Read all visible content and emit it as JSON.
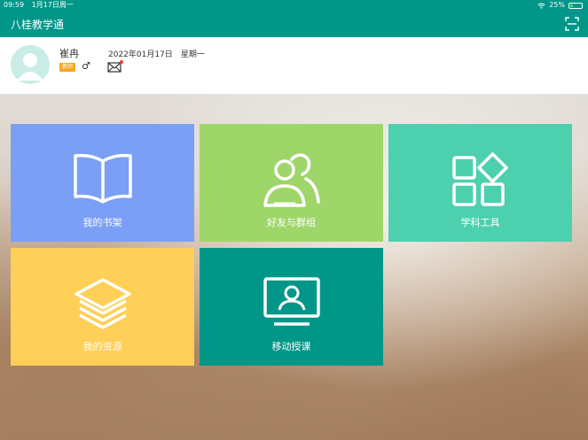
{
  "status_bar": {
    "time": "09:59",
    "date": "1月17日周一",
    "battery": "25%",
    "battery_level": 0.25
  },
  "app": {
    "title": "八桂教学通"
  },
  "profile": {
    "name": "崔冉",
    "role_badge": "教师",
    "gender_symbol": "♂",
    "date": "2022年01月17日",
    "weekday": "星期一"
  },
  "tiles": [
    {
      "label": "我的书架",
      "icon": "book-icon",
      "color": "#7b9ff5"
    },
    {
      "label": "好友与群组",
      "icon": "friends-group-icon",
      "color": "#9fd66a"
    },
    {
      "label": "学科工具",
      "icon": "tools-grid-icon",
      "color": "#4cd0ae"
    },
    {
      "label": "我的资源",
      "icon": "layers-icon",
      "color": "#ffcf57"
    },
    {
      "label": "移动授课",
      "icon": "screen-presenter-icon",
      "color": "#009688"
    }
  ],
  "colors": {
    "primary": "#009688",
    "badge": "#f5a623",
    "notification_dot": "#f44336"
  }
}
